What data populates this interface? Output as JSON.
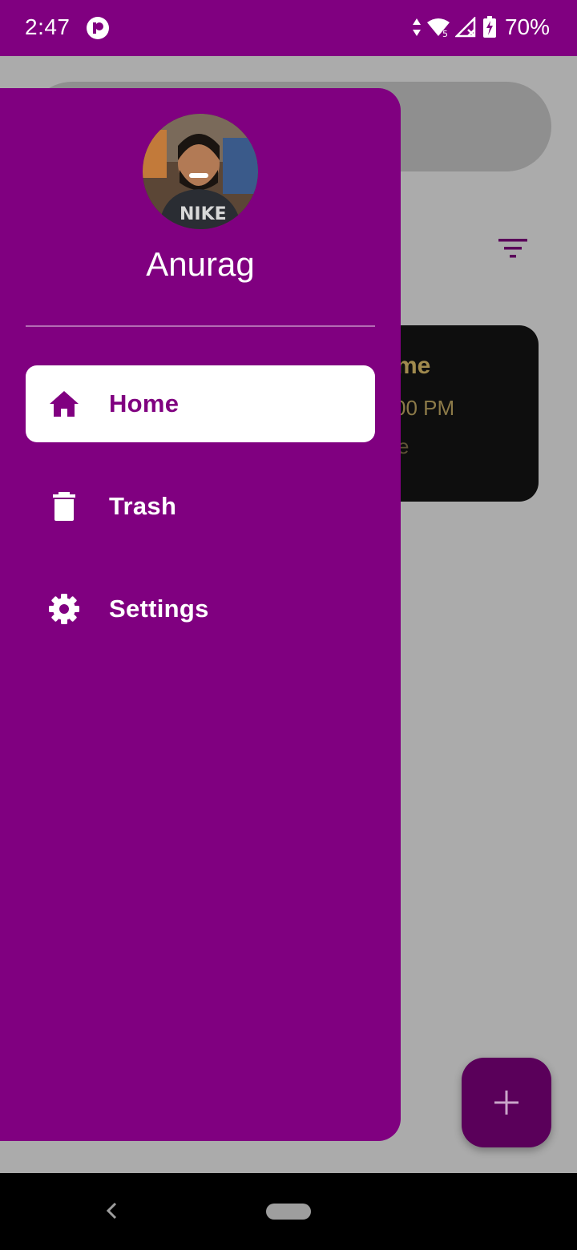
{
  "status_bar": {
    "time": "2:47",
    "battery": "70%",
    "signal_badge": "5"
  },
  "background": {
    "card": {
      "title": "me",
      "time": "00 PM",
      "note": "e"
    }
  },
  "drawer": {
    "user_name": "Anurag",
    "items": [
      {
        "label": "Home",
        "icon": "home-icon",
        "selected": true
      },
      {
        "label": "Trash",
        "icon": "trash-icon",
        "selected": false
      },
      {
        "label": "Settings",
        "icon": "gear-icon",
        "selected": false
      }
    ]
  },
  "colors": {
    "primary": "#800080",
    "scrim": "#ababab",
    "fab": "#5a005a"
  }
}
